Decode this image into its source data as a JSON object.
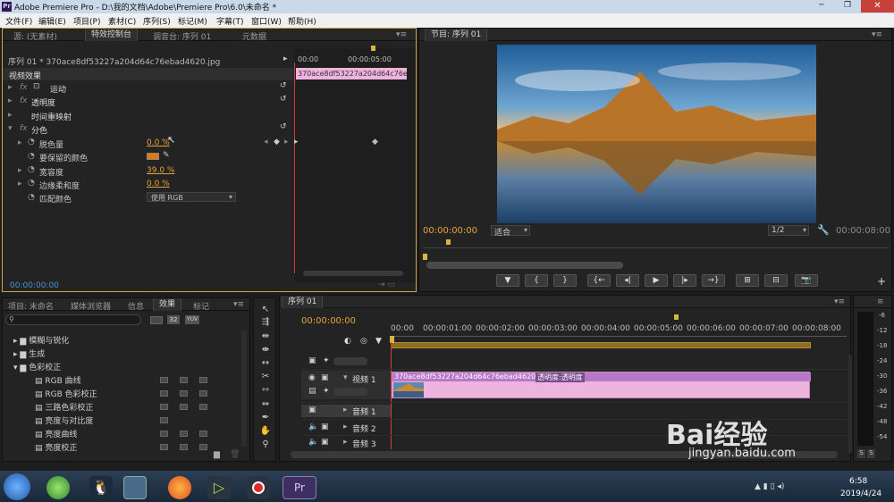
{
  "app": {
    "title": "Adobe Premiere Pro - D:\\我的文档\\Adobe\\Premiere Pro\\6.0\\未命名 *",
    "logo": "Pr"
  },
  "menu": [
    "文件(F)",
    "编辑(E)",
    "项目(P)",
    "素材(C)",
    "序列(S)",
    "标记(M)",
    "字幕(T)",
    "窗口(W)",
    "帮助(H)"
  ],
  "source_panel": {
    "tabs": [
      "源: (无素材)",
      "特效控制台",
      "调音台: 序列 01",
      "元数据"
    ],
    "clip_header": "序列 01 * 370ace8df53227a204d64c76ebad4620.jpg",
    "ruler": [
      "00:00",
      "00:00:05:00"
    ],
    "clip_bar": "370ace8df53227a204d64c76ebad4620.jpg",
    "section": "视频效果",
    "effects": [
      "运动",
      "透明度",
      "时间重映射",
      "分色"
    ],
    "params": [
      {
        "label": "脱色量",
        "value": "0.0 %"
      },
      {
        "label": "要保留的颜色",
        "value": ""
      },
      {
        "label": "宽容度",
        "value": "39.0 %"
      },
      {
        "label": "边缘柔和度",
        "value": "0.0 %"
      },
      {
        "label": "匹配颜色",
        "value": "使用 RGB"
      }
    ],
    "timecode": "00:00:00:00"
  },
  "program_panel": {
    "tab": "节目: 序列 01",
    "timecode": "00:00:00:00",
    "fit": "适合",
    "quality": "1/2",
    "duration": "00:00:08:00"
  },
  "project_panel": {
    "tabs": [
      "项目: 未命名",
      "媒体浏览器",
      "信息",
      "效果",
      "标记"
    ],
    "folders": [
      "模糊与锐化",
      "生成",
      "色彩校正"
    ],
    "items": [
      "RGB 曲线",
      "RGB 色彩校正",
      "三路色彩校正",
      "亮度与对比度",
      "亮度曲线",
      "亮度校正"
    ],
    "badges": [
      "32",
      "YUV"
    ]
  },
  "timeline": {
    "tab": "序列 01",
    "timecode": "00:00:00:00",
    "ruler": [
      "00:00",
      "00:00:01:00",
      "00:00:02:00",
      "00:00:03:00",
      "00:00:04:00",
      "00:00:05:00",
      "00:00:06:00",
      "00:00:07:00",
      "00:00:08:00"
    ],
    "tracks": {
      "video": "视频 1",
      "audio": [
        "音频 1",
        "音频 2",
        "音频 3"
      ]
    },
    "clip_name": "370ace8df53227a204d64c76ebad4620.jpg",
    "clip_fx": "透明度:透明度"
  },
  "meter": {
    "labels": [
      "-6",
      "-12",
      "-18",
      "-24",
      "-30",
      "-36",
      "-42",
      "-48",
      "-54"
    ],
    "solo": [
      "S",
      "S"
    ]
  },
  "taskbar": {
    "time": "6:58",
    "date": "2019/4/24"
  },
  "watermark": {
    "text": "Bai经验",
    "url": "jingyan.baidu.com"
  },
  "colors": {
    "accent": "#e8a33a",
    "clip": "#efb3e0",
    "clip_header": "#b778c8",
    "playhead": "#d23c3c",
    "blue_link": "#4b8fe0"
  }
}
